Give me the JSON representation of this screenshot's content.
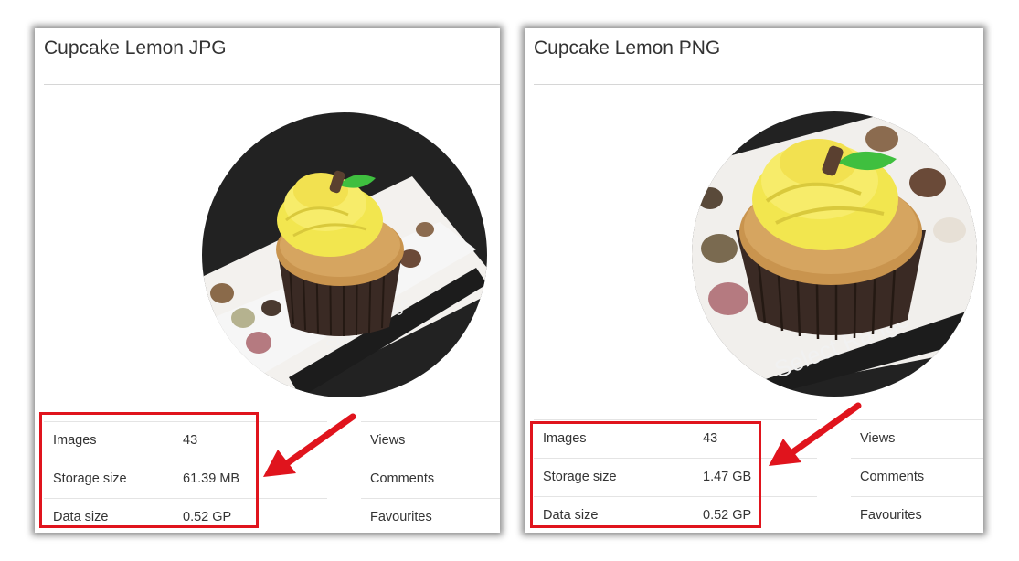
{
  "cards": [
    {
      "title": "Cupcake Lemon JPG",
      "stats": [
        {
          "label": "Images",
          "value": "43"
        },
        {
          "label": "Storage size",
          "value": "61.39 MB"
        },
        {
          "label": "Data size",
          "value": "0.52 GP"
        }
      ],
      "side_stats": [
        "Views",
        "Comments",
        "Favourites"
      ]
    },
    {
      "title": "Cupcake Lemon PNG",
      "stats": [
        {
          "label": "Images",
          "value": "43"
        },
        {
          "label": "Storage size",
          "value": "1.47 GB"
        },
        {
          "label": "Data size",
          "value": "0.52 GP"
        }
      ],
      "side_stats": [
        "Views",
        "Comments",
        "Favourites"
      ]
    }
  ],
  "colors": {
    "highlight": "#e0141d",
    "text": "#333333",
    "photo_background": "#222222",
    "frosting": "#f2e64f",
    "cake": "#c9944e",
    "liner": "#3a2a24",
    "leaf": "#3fbf3f"
  },
  "photo": {
    "sign_text": "Select Range"
  }
}
